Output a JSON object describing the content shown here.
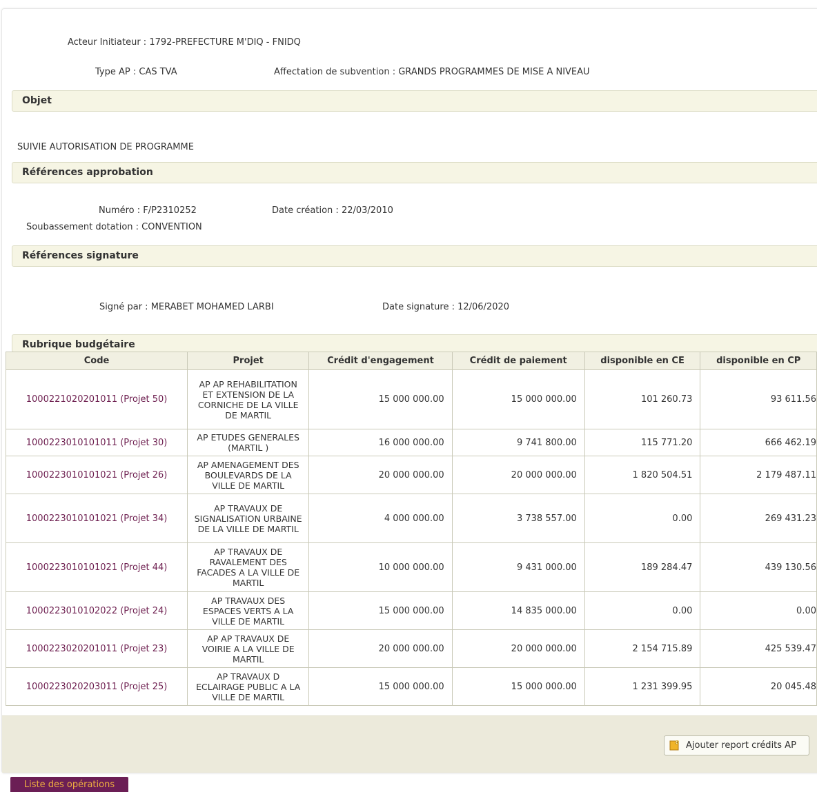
{
  "header": {
    "acteur_label": "Acteur Initiateur :",
    "acteur_value": "1792-PREFECTURE M'DIQ - FNIDQ",
    "type_label": "Type AP :",
    "type_value": "CAS TVA",
    "affectation_label": "Affectation de subvention :",
    "affectation_value": "GRANDS PROGRAMMES DE MISE A NIVEAU"
  },
  "objet": {
    "title": "Objet",
    "text": "SUIVIE AUTORISATION DE PROGRAMME"
  },
  "approbation": {
    "title": "Références approbation",
    "numero_label": "Numéro :",
    "numero_value": "F/P2310252",
    "date_label": "Date création :",
    "date_value": "22/03/2010",
    "soub_label": "Soubassement dotation :",
    "soub_value": "CONVENTION"
  },
  "signature": {
    "title": "Références signature",
    "signe_label": "Signé par :",
    "signe_value": "MERABET MOHAMED LARBI",
    "date_label": "Date signature :",
    "date_value": "12/06/2020"
  },
  "rubrique": {
    "title": "Rubrique budgétaire",
    "columns": [
      "Code",
      "Projet",
      "Crédit d'engagement",
      "Crédit de paiement",
      "disponible en CE",
      "disponible en CP"
    ],
    "rows": [
      {
        "code": "1000221020201011 (Projet 50)",
        "projet": "AP AP REHABILITATION ET EXTENSION DE LA CORNICHE DE LA VILLE DE MARTIL",
        "ce": "15 000 000.00",
        "cp": "15 000 000.00",
        "dce": "101 260.73",
        "dcp": "93 611.56"
      },
      {
        "code": "1000223010101011 (Projet 30)",
        "projet": "AP ETUDES GENERALES (MARTIL )",
        "ce": "16 000 000.00",
        "cp": "9 741 800.00",
        "dce": "115 771.20",
        "dcp": "666 462.19"
      },
      {
        "code": "1000223010101021 (Projet 26)",
        "projet": "AP AMENAGEMENT DES BOULEVARDS DE LA VILLE DE MARTIL",
        "ce": "20 000 000.00",
        "cp": "20 000 000.00",
        "dce": "1 820 504.51",
        "dcp": "2 179 487.11"
      },
      {
        "code": "1000223010101021 (Projet 34)",
        "projet": "AP TRAVAUX DE SIGNALISATION URBAINE DE LA VILLE DE MARTIL",
        "ce": "4 000 000.00",
        "cp": "3 738 557.00",
        "dce": "0.00",
        "dcp": "269 431.23"
      },
      {
        "code": "1000223010101021 (Projet 44)",
        "projet": "AP TRAVAUX DE RAVALEMENT DES FACADES A LA VILLE DE MARTIL",
        "ce": "10 000 000.00",
        "cp": "9 431 000.00",
        "dce": "189 284.47",
        "dcp": "439 130.56"
      },
      {
        "code": "1000223010102022 (Projet 24)",
        "projet": "AP TRAVAUX DES ESPACES VERTS A LA VILLE DE MARTIL",
        "ce": "15 000 000.00",
        "cp": "14 835 000.00",
        "dce": "0.00",
        "dcp": "0.00"
      },
      {
        "code": "1000223020201011 (Projet 23)",
        "projet": "AP AP TRAVAUX DE VOIRIE A LA VILLE DE MARTIL",
        "ce": "20 000 000.00",
        "cp": "20 000 000.00",
        "dce": "2 154 715.89",
        "dcp": "425 539.47"
      },
      {
        "code": "1000223020203011 (Projet 25)",
        "projet": "AP TRAVAUX D ECLAIRAGE PUBLIC A LA VILLE DE MARTIL",
        "ce": "15 000 000.00",
        "cp": "15 000 000.00",
        "dce": "1 231 399.95",
        "dcp": "20 045.48"
      }
    ]
  },
  "actions": {
    "add_report_label": "Ajouter report crédits AP",
    "add_report_icon": "document-add-icon",
    "list_ops_label": "Liste des opérations"
  },
  "colors": {
    "section_bg": "#f6f5e4",
    "code_link": "#6d1e4f",
    "ops_bg": "#6b1e55",
    "ops_text": "#f0b040"
  }
}
